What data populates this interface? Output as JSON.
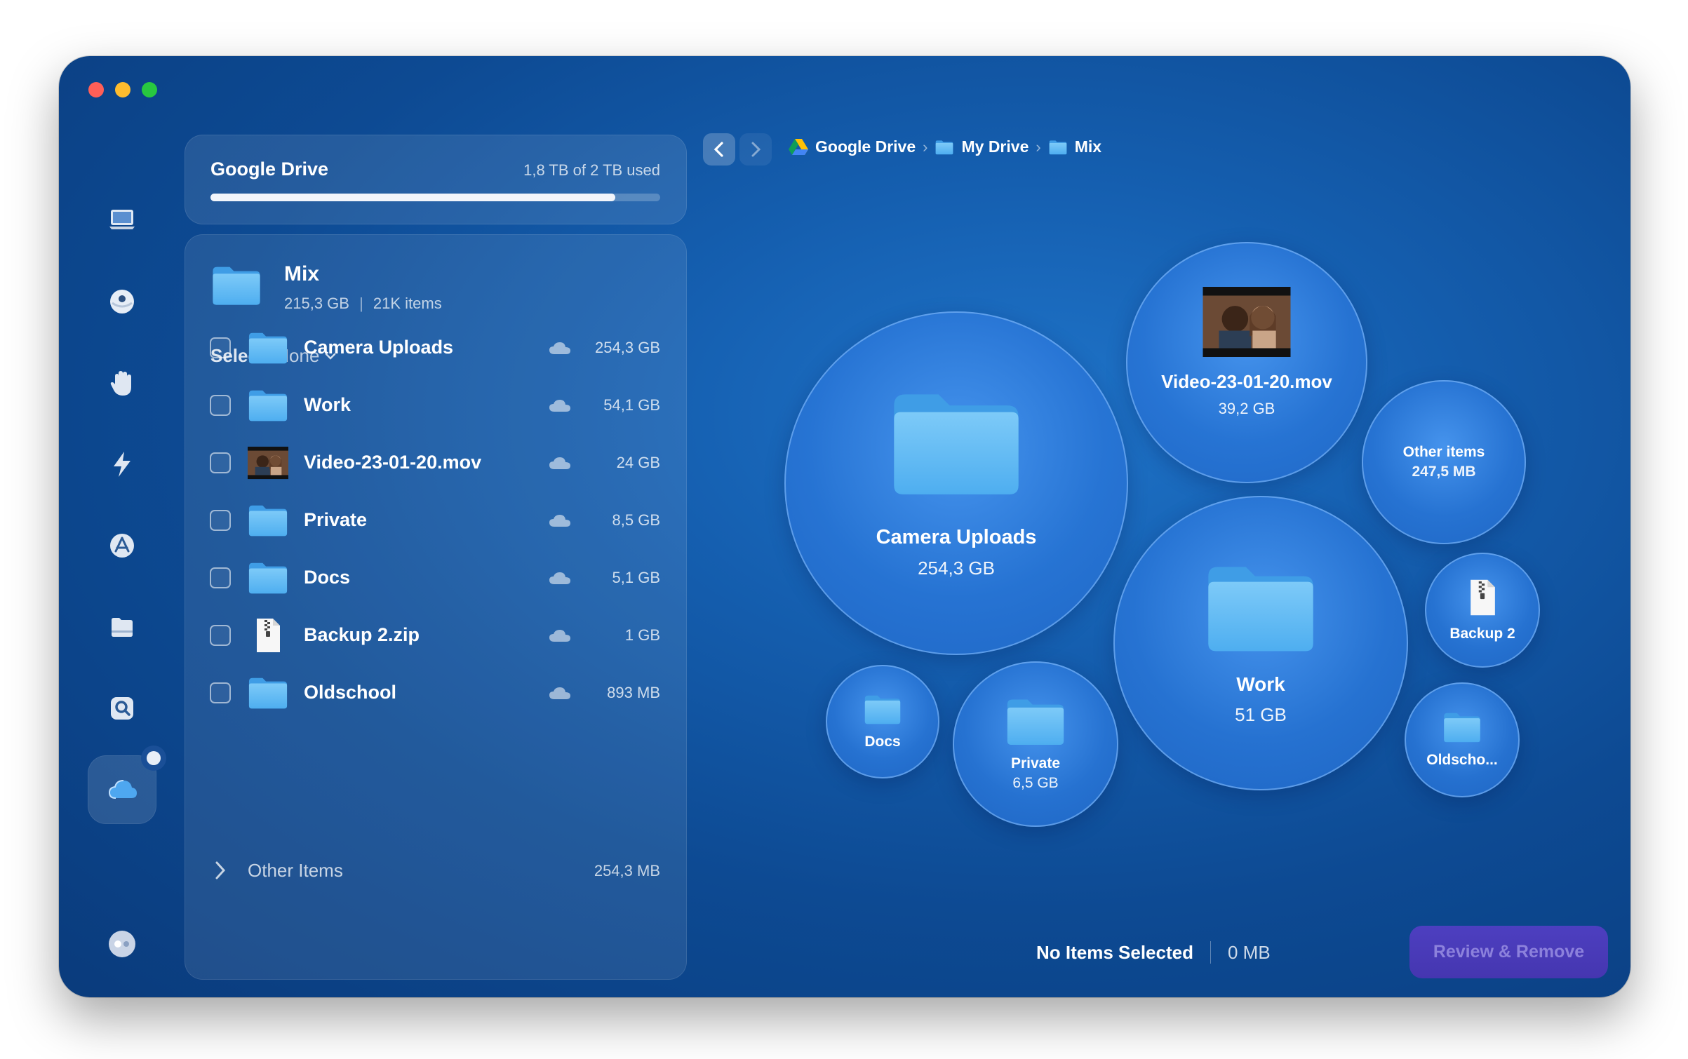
{
  "drive": {
    "title": "Google Drive",
    "used_text": "1,8 TB of 2 TB used",
    "used_fraction": 0.9
  },
  "folder": {
    "name": "Mix",
    "size": "215,3 GB",
    "items": "21K items",
    "meta_sep": "|"
  },
  "select": {
    "label": "Select:",
    "value": "None"
  },
  "rows": [
    {
      "name": "Camera Uploads",
      "size": "254,3 GB",
      "icon": "folder-icon"
    },
    {
      "name": "Work",
      "size": "54,1 GB",
      "icon": "folder-icon"
    },
    {
      "name": "Video-23-01-20.mov",
      "size": "24 GB",
      "icon": "video-thumbnail"
    },
    {
      "name": "Private",
      "size": "8,5 GB",
      "icon": "folder-icon"
    },
    {
      "name": "Docs",
      "size": "5,1 GB",
      "icon": "folder-icon"
    },
    {
      "name": "Backup 2.zip",
      "size": "1 GB",
      "icon": "zip-file-icon"
    },
    {
      "name": "Oldschool",
      "size": "893 MB",
      "icon": "folder-icon"
    }
  ],
  "other_items": {
    "label": "Other Items",
    "size": "254,3 MB"
  },
  "breadcrumb": {
    "sep": "›",
    "items": [
      "Google Drive",
      "My Drive",
      "Mix"
    ]
  },
  "bubbles": {
    "camera_uploads": {
      "name": "Camera Uploads",
      "size": "254,3 GB"
    },
    "video": {
      "name": "Video-23-01-20.mov",
      "size": "39,2 GB"
    },
    "other": {
      "name": "Other items",
      "size": "247,5 MB"
    },
    "work": {
      "name": "Work",
      "size": "51 GB"
    },
    "backup": {
      "name": "Backup 2"
    },
    "oldschool": {
      "name": "Oldscho..."
    },
    "docs": {
      "name": "Docs"
    },
    "private": {
      "name": "Private",
      "size": "6,5 GB"
    }
  },
  "footer": {
    "status": "No Items Selected",
    "total": "0 MB",
    "action": "Review & Remove"
  },
  "colors": {
    "window_bg": "#155fb0",
    "folder_blue": "#5cb8f5",
    "action_button": "#4536b0"
  }
}
